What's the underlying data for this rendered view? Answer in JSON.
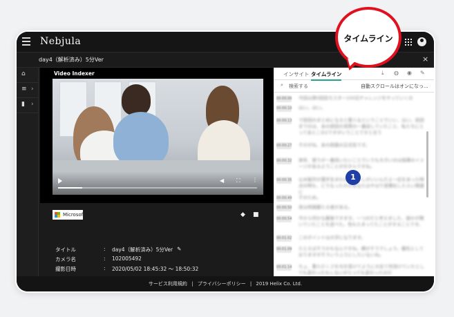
{
  "app": {
    "brand": "Nebjula"
  },
  "titlebar": {
    "title": "day4（解析済み）5分Ver",
    "close": "×"
  },
  "player": {
    "label": "Video Indexer",
    "progress": 0.12,
    "sponsor": "Microsoft"
  },
  "meta": {
    "rows": [
      {
        "key": "タイトル",
        "colon": ":",
        "value": "day4（解析済み）5分Ver"
      },
      {
        "key": "カメラ名",
        "colon": ":",
        "value": "102005492"
      },
      {
        "key": "撮影日時",
        "colon": ":",
        "value": "2020/05/02 18:45:32 ～ 18:50:32"
      }
    ]
  },
  "panel": {
    "tabs": [
      {
        "label": "インサイト"
      },
      {
        "label": "タイムライン"
      }
    ],
    "search_placeholder": "検索する",
    "auto_scroll": "自動スクロールはオンになっ...",
    "entries": [
      {
        "time": "00:00:00",
        "text": "今回は第0回目モスター100日チャレンジをやっていくの"
      },
      {
        "time": "00:00:10",
        "text": "はい。はい。"
      },
      {
        "time": "00:00:13",
        "text": "で前回のまとめになると愛人なということでいい、はい。前回までのは、あの前回の実際の一番話していたこと、私たちにとってあとこの2ですがいうことですと言う"
      },
      {
        "time": "00:00:27",
        "text": "そのがね、あの前面の正式名です。"
      },
      {
        "time": "00:00:32",
        "text": "来年、使うが一番改いたいことでいうも大きいのは指導のイメージがあるようことが示すんですね。"
      },
      {
        "time": "00:00:35",
        "text": "公木製作が選手生まれがもう少しがいいんだよ一応をあった時点の時も、どうなったかがあなたはやはり習慣化したらい関連に"
      },
      {
        "time": "00:00:49",
        "text": "そのため。"
      },
      {
        "time": "00:00:50",
        "text": "実は両親最たる者がある。"
      },
      {
        "time": "00:00:54",
        "text": "今から何かな最後ですます。一つのだと考えました、誰かが聞いていたことを述べた。色もたまってたことがすることです。"
      },
      {
        "time": "00:01:02",
        "text": "このポイントは大学になります。"
      },
      {
        "time": "00:01:09",
        "text": "たとえばそうかもなんですね。横がそうでしょう。優先としておりますがそういうふうにしたいないね。"
      },
      {
        "time": "00:01:14",
        "text": "ちょ、重ただくさを与を受けてように大化て何流けていたとしても変わったもしないがとっても変わったのだ"
      }
    ]
  },
  "footer": {
    "terms": "サービス利用規約",
    "sep1": "|",
    "privacy": "プライバシーポリシー",
    "sep2": "|",
    "copyright": "2019 Helix Co. Ltd."
  },
  "callout": {
    "text": "タイムライン",
    "badge": "1"
  },
  "colors": {
    "accent": "#20a590",
    "callout_border": "#e0101e",
    "badge": "#1f3fa6"
  }
}
